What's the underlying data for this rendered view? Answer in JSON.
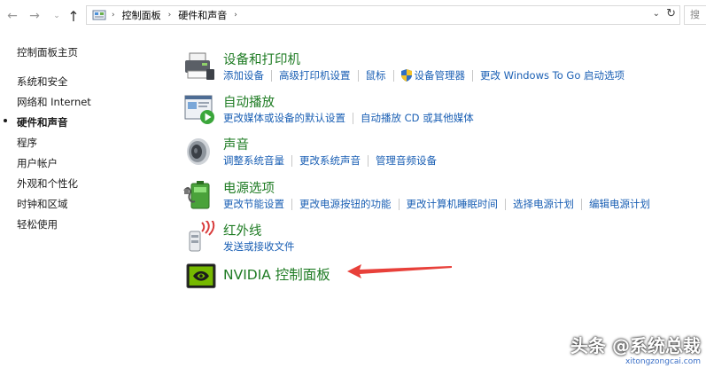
{
  "addressbar": {
    "breadcrumbs": [
      "控制面板",
      "硬件和声音"
    ],
    "search_placeholder": "搜"
  },
  "sidebar": {
    "items": [
      {
        "label": "控制面板主页"
      },
      {
        "label": "系统和安全"
      },
      {
        "label": "网络和 Internet"
      },
      {
        "label": "硬件和声音",
        "active": true
      },
      {
        "label": "程序"
      },
      {
        "label": "用户帐户"
      },
      {
        "label": "外观和个性化"
      },
      {
        "label": "时钟和区域"
      },
      {
        "label": "轻松使用"
      }
    ]
  },
  "categories": [
    {
      "title": "设备和打印机",
      "icon": "printer-icon",
      "links": [
        "添加设备",
        "高级打印机设置",
        "鼠标",
        "设备管理器",
        "更改 Windows To Go 启动选项"
      ]
    },
    {
      "title": "自动播放",
      "icon": "autoplay-icon",
      "links": [
        "更改媒体或设备的默认设置",
        "自动播放 CD 或其他媒体"
      ]
    },
    {
      "title": "声音",
      "icon": "speaker-icon",
      "links": [
        "调整系统音量",
        "更改系统声音",
        "管理音频设备"
      ]
    },
    {
      "title": "电源选项",
      "icon": "battery-icon",
      "links": [
        "更改节能设置",
        "更改电源按钮的功能",
        "更改计算机睡眠时间",
        "选择电源计划",
        "编辑电源计划"
      ]
    },
    {
      "title": "红外线",
      "icon": "infrared-icon",
      "links": [
        "发送或接收文件"
      ]
    },
    {
      "title": "NVIDIA 控制面板",
      "icon": "nvidia-icon",
      "links": []
    }
  ],
  "watermark": {
    "main": "头条 @系统总裁",
    "sub": "xitongzongcai.com"
  },
  "colors": {
    "link": "#1a5fb4",
    "title": "#1e7b23",
    "arrow": "#e8403a"
  }
}
